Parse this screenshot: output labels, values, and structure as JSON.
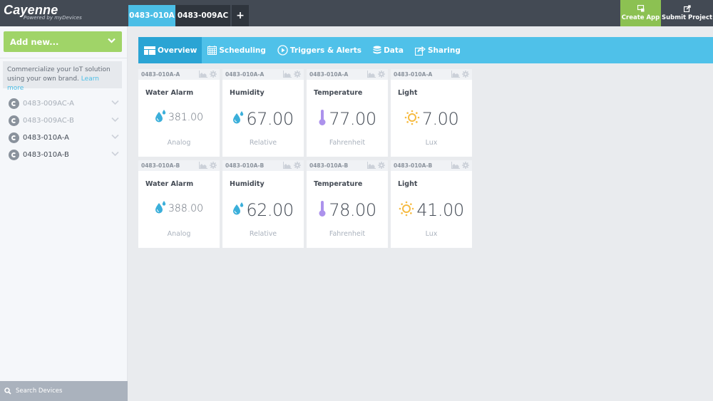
{
  "app": {
    "logo": "Cayenne",
    "logo_sub": "Powered by myDevices"
  },
  "header": {
    "tabs": [
      {
        "label": "0483-010A",
        "active": true
      },
      {
        "label": "0483-009AC",
        "active": false
      }
    ],
    "add_tab_label": "+",
    "create_app_label": "Create App",
    "submit_project_label": "Submit Project"
  },
  "sidebar": {
    "add_new_label": "Add new...",
    "promo_text": "Commercialize your IoT solution using your own brand.",
    "promo_link": "Learn more",
    "devices": [
      {
        "name": "0483-009AC-A",
        "state": "dim"
      },
      {
        "name": "0483-009AC-B",
        "state": "dim"
      },
      {
        "name": "0483-010A-A",
        "state": "bright"
      },
      {
        "name": "0483-010A-B",
        "state": "bright"
      }
    ],
    "search_placeholder": "Search Devices"
  },
  "subnav": {
    "items": [
      {
        "label": "Overview",
        "icon": "overview-icon",
        "active": true
      },
      {
        "label": "Scheduling",
        "icon": "calendar-icon",
        "active": false
      },
      {
        "label": "Triggers & Alerts",
        "icon": "play-circle-icon",
        "active": false
      },
      {
        "label": "Data",
        "icon": "database-icon",
        "active": false
      },
      {
        "label": "Sharing",
        "icon": "share-icon",
        "active": false
      }
    ]
  },
  "colors": {
    "accent_blue": "#4fc1e9",
    "active_blue": "#2aa4d4",
    "green": "#a0d468",
    "water": "#3bafda",
    "thermo": "#ac92ec",
    "sun": "#f6bb42"
  },
  "widgets": [
    {
      "device": "0483-010A-A",
      "title": "Water Alarm",
      "value": "381.00",
      "unit": "Analog",
      "icon": "water-drop-icon",
      "size": "small"
    },
    {
      "device": "0483-010A-A",
      "title": "Humidity",
      "value": "67.00",
      "unit": "Relative",
      "icon": "water-drop-icon",
      "size": "large"
    },
    {
      "device": "0483-010A-A",
      "title": "Temperature",
      "value": "77.00",
      "unit": "Fahrenheit",
      "icon": "thermometer-icon",
      "size": "large"
    },
    {
      "device": "0483-010A-A",
      "title": "Light",
      "value": "7.00",
      "unit": "Lux",
      "icon": "sun-icon",
      "size": "large"
    },
    {
      "device": "0483-010A-B",
      "title": "Water Alarm",
      "value": "388.00",
      "unit": "Analog",
      "icon": "water-drop-icon",
      "size": "small"
    },
    {
      "device": "0483-010A-B",
      "title": "Humidity",
      "value": "62.00",
      "unit": "Relative",
      "icon": "water-drop-icon",
      "size": "large"
    },
    {
      "device": "0483-010A-B",
      "title": "Temperature",
      "value": "78.00",
      "unit": "Fahrenheit",
      "icon": "thermometer-icon",
      "size": "large"
    },
    {
      "device": "0483-010A-B",
      "title": "Light",
      "value": "41.00",
      "unit": "Lux",
      "icon": "sun-icon",
      "size": "large"
    }
  ]
}
